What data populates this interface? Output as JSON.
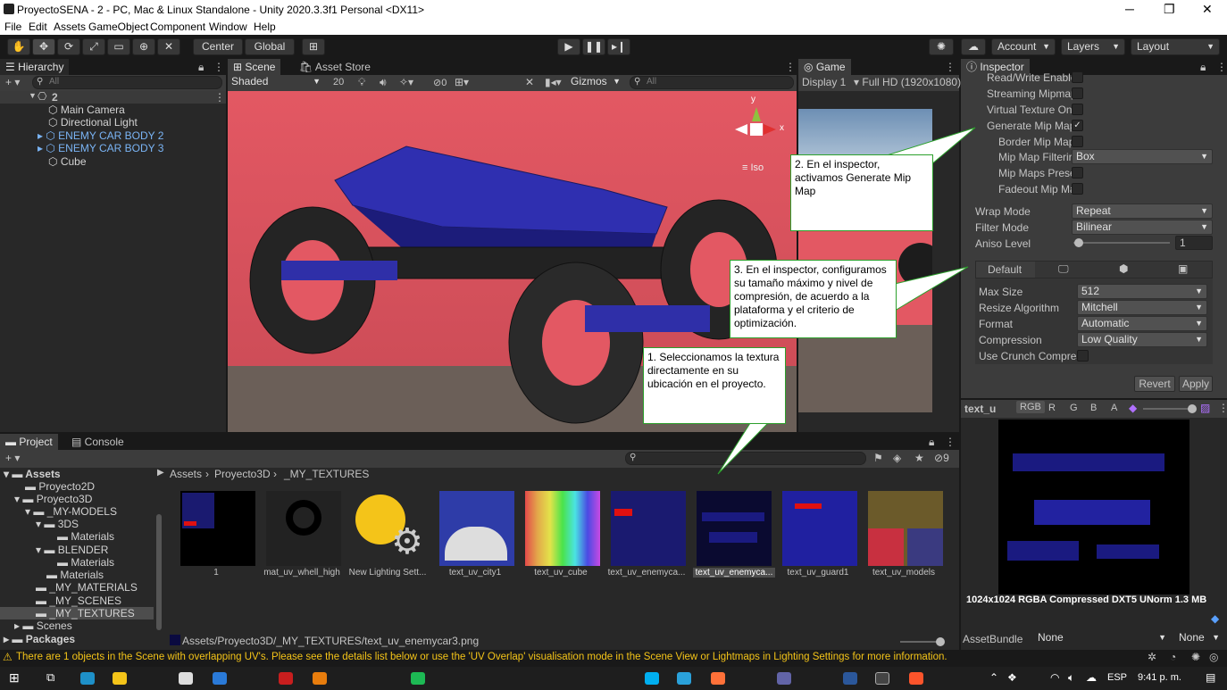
{
  "window": {
    "title": "ProyectoSENA - 2 - PC, Mac & Linux Standalone - Unity 2020.3.3f1 Personal <DX11>",
    "minimize": "─",
    "maximize": "❐",
    "close": "✕"
  },
  "menu": [
    "File",
    "Edit",
    "Assets",
    "GameObject",
    "Component",
    "Window",
    "Help"
  ],
  "toolbar": {
    "center": "Center",
    "global": "Global",
    "account": "Account",
    "layers": "Layers",
    "layout": "Layout"
  },
  "hierarchy": {
    "tab": "Hierarchy",
    "search_placeholder": "All",
    "scene": "2",
    "items": [
      "Main Camera",
      "Directional Light",
      "ENEMY CAR BODY 2",
      "ENEMY CAR BODY 3",
      "Cube"
    ]
  },
  "scene": {
    "tab_scene": "Scene",
    "tab_store": "Asset Store",
    "shading": "Shaded",
    "mode2d": "20",
    "hidden": "0",
    "gizmos": "Gizmos",
    "search": "All",
    "axis_y": "y",
    "axis_x": "x",
    "iso": "Iso"
  },
  "game": {
    "tab": "Game",
    "display": "Display 1",
    "resolution": "Full HD (1920x1080)"
  },
  "inspector": {
    "tab": "Inspector",
    "checks": [
      {
        "label": "Read/Write Enable",
        "checked": false
      },
      {
        "label": "Streaming Mipmap",
        "checked": false
      },
      {
        "label": "Virtual Texture On",
        "checked": false
      },
      {
        "label": "Generate Mip Map",
        "checked": true
      },
      {
        "label": "Border Mip Map",
        "checked": false
      }
    ],
    "mip_filter_label": "Mip Map Filterir",
    "mip_filter_value": "Box",
    "mip_preserve": "Mip Maps Prese",
    "fadeout": "Fadeout Mip Ma",
    "wrap_label": "Wrap Mode",
    "wrap_value": "Repeat",
    "filter_label": "Filter Mode",
    "filter_value": "Bilinear",
    "aniso_label": "Aniso Level",
    "aniso_value": "1",
    "aniso_level": 0.06,
    "platform_tab": "Default",
    "maxsize_label": "Max Size",
    "maxsize_value": "512",
    "resize_label": "Resize Algorithm",
    "resize_value": "Mitchell",
    "format_label": "Format",
    "format_value": "Automatic",
    "compression_label": "Compression",
    "compression_value": "Low Quality",
    "crunch_label": "Use Crunch Compres",
    "revert": "Revert",
    "apply": "Apply"
  },
  "preview": {
    "name": "text_u",
    "channels": [
      "RGB",
      "R",
      "G",
      "B",
      "A"
    ],
    "info": "1024x1024  RGBA Compressed DXT5 UNorm   1.3 MB",
    "assetbundle": "AssetBundle",
    "ab_value": "None",
    "ab_variant": "None"
  },
  "project": {
    "tab_project": "Project",
    "tab_console": "Console",
    "hidden_count": "9",
    "breadcrumb": [
      "Assets",
      "Proyecto3D",
      "_MY_TEXTURES"
    ],
    "tree": [
      {
        "label": "Assets",
        "indent": 0,
        "bold": true
      },
      {
        "label": "Proyecto2D",
        "indent": 1
      },
      {
        "label": "Proyecto3D",
        "indent": 1
      },
      {
        "label": "_MY-MODELS",
        "indent": 2
      },
      {
        "label": "3DS",
        "indent": 3
      },
      {
        "label": "Materials",
        "indent": 4
      },
      {
        "label": "BLENDER",
        "indent": 3
      },
      {
        "label": "Materials",
        "indent": 4
      },
      {
        "label": "Materials",
        "indent": 3
      },
      {
        "label": "_MY_MATERIALS",
        "indent": 2
      },
      {
        "label": "_MY_SCENES",
        "indent": 2
      },
      {
        "label": "_MY_TEXTURES",
        "indent": 2
      },
      {
        "label": "Scenes",
        "indent": 1
      },
      {
        "label": "Packages",
        "indent": 0,
        "bold": true
      }
    ],
    "assets": [
      "1",
      "mat_uv_whell_high",
      "New Lighting Sett...",
      "text_uv_city1",
      "text_uv_cube",
      "text_uv_enemyca...",
      "text_uv_enemyca...",
      "text_uv_guard1",
      "text_uv_models"
    ],
    "path": "Assets/Proyecto3D/_MY_TEXTURES/text_uv_enemycar3.png"
  },
  "status": "There are 1 objects in the Scene with overlapping UV's. Please see the details list below or use the 'UV Overlap' visualisation mode in the Scene View or Lightmaps in Lighting Settings for more information.",
  "callouts": {
    "c1": "1. Seleccionamos la textura directamente en su ubicación en el proyecto.",
    "c2": "2. En el inspector, activamos Generate Mip Map",
    "c3": "3. En el inspector, configuramos su tamaño máximo y nivel de compresión, de acuerdo a la plataforma y el criterio de optimización."
  },
  "taskbar": {
    "lang": "ESP",
    "time": "9:41 p. m."
  },
  "colors": {
    "accent": "#2ca02c",
    "scene_bg": "#d9505a",
    "link_blue": "#7ab4f5"
  }
}
